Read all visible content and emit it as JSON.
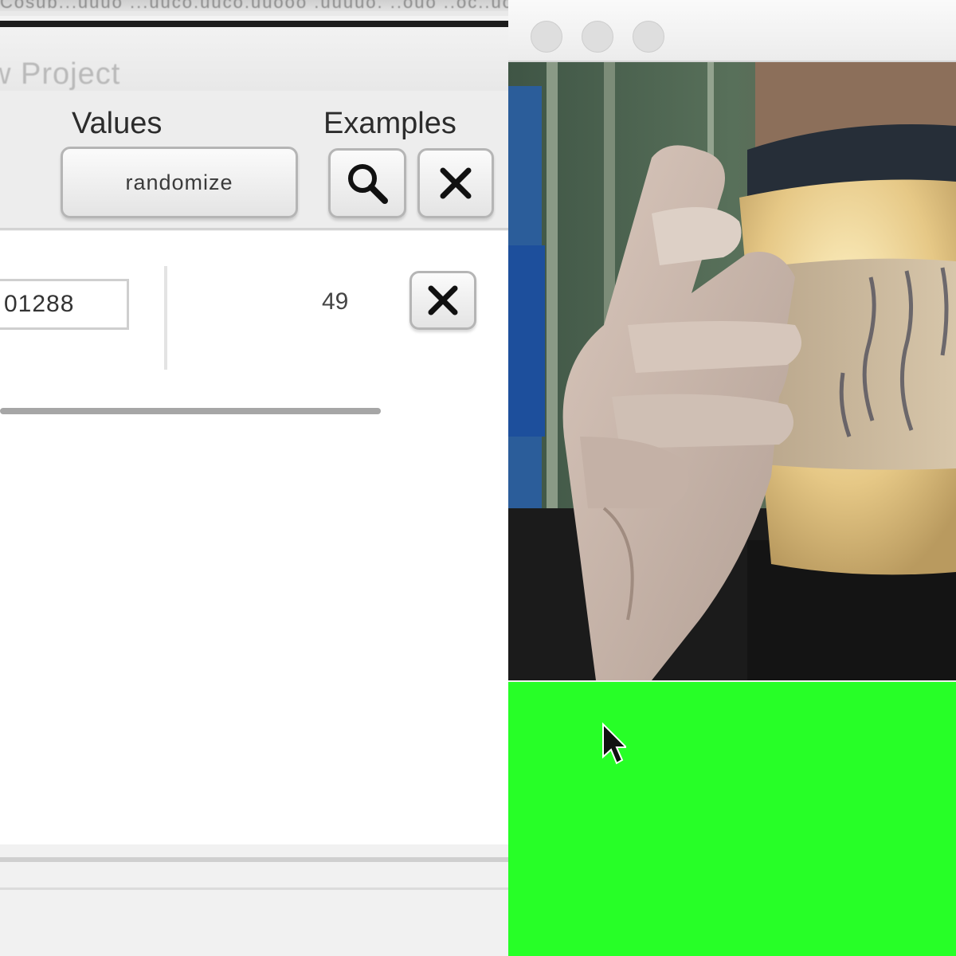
{
  "desktop": {
    "background_text": "Cosub...uuuo ...uuco.uuco.uuooo .uuuuo. ..ouo ..oc..uoo..."
  },
  "project_window": {
    "title": "w Project",
    "headers": {
      "values": "Values",
      "examples": "Examples"
    },
    "randomize_label": "randomize",
    "row": {
      "value": "01288",
      "example_count": "49"
    }
  },
  "camera_window": {
    "output_color": "#27ff27"
  },
  "icons": {
    "search": "search-icon",
    "clear": "close-icon",
    "delete": "close-icon",
    "cursor": "mouse-cursor-icon"
  },
  "colors": {
    "output_green": "#27ff27",
    "window_bg": "#f3f3f3"
  }
}
